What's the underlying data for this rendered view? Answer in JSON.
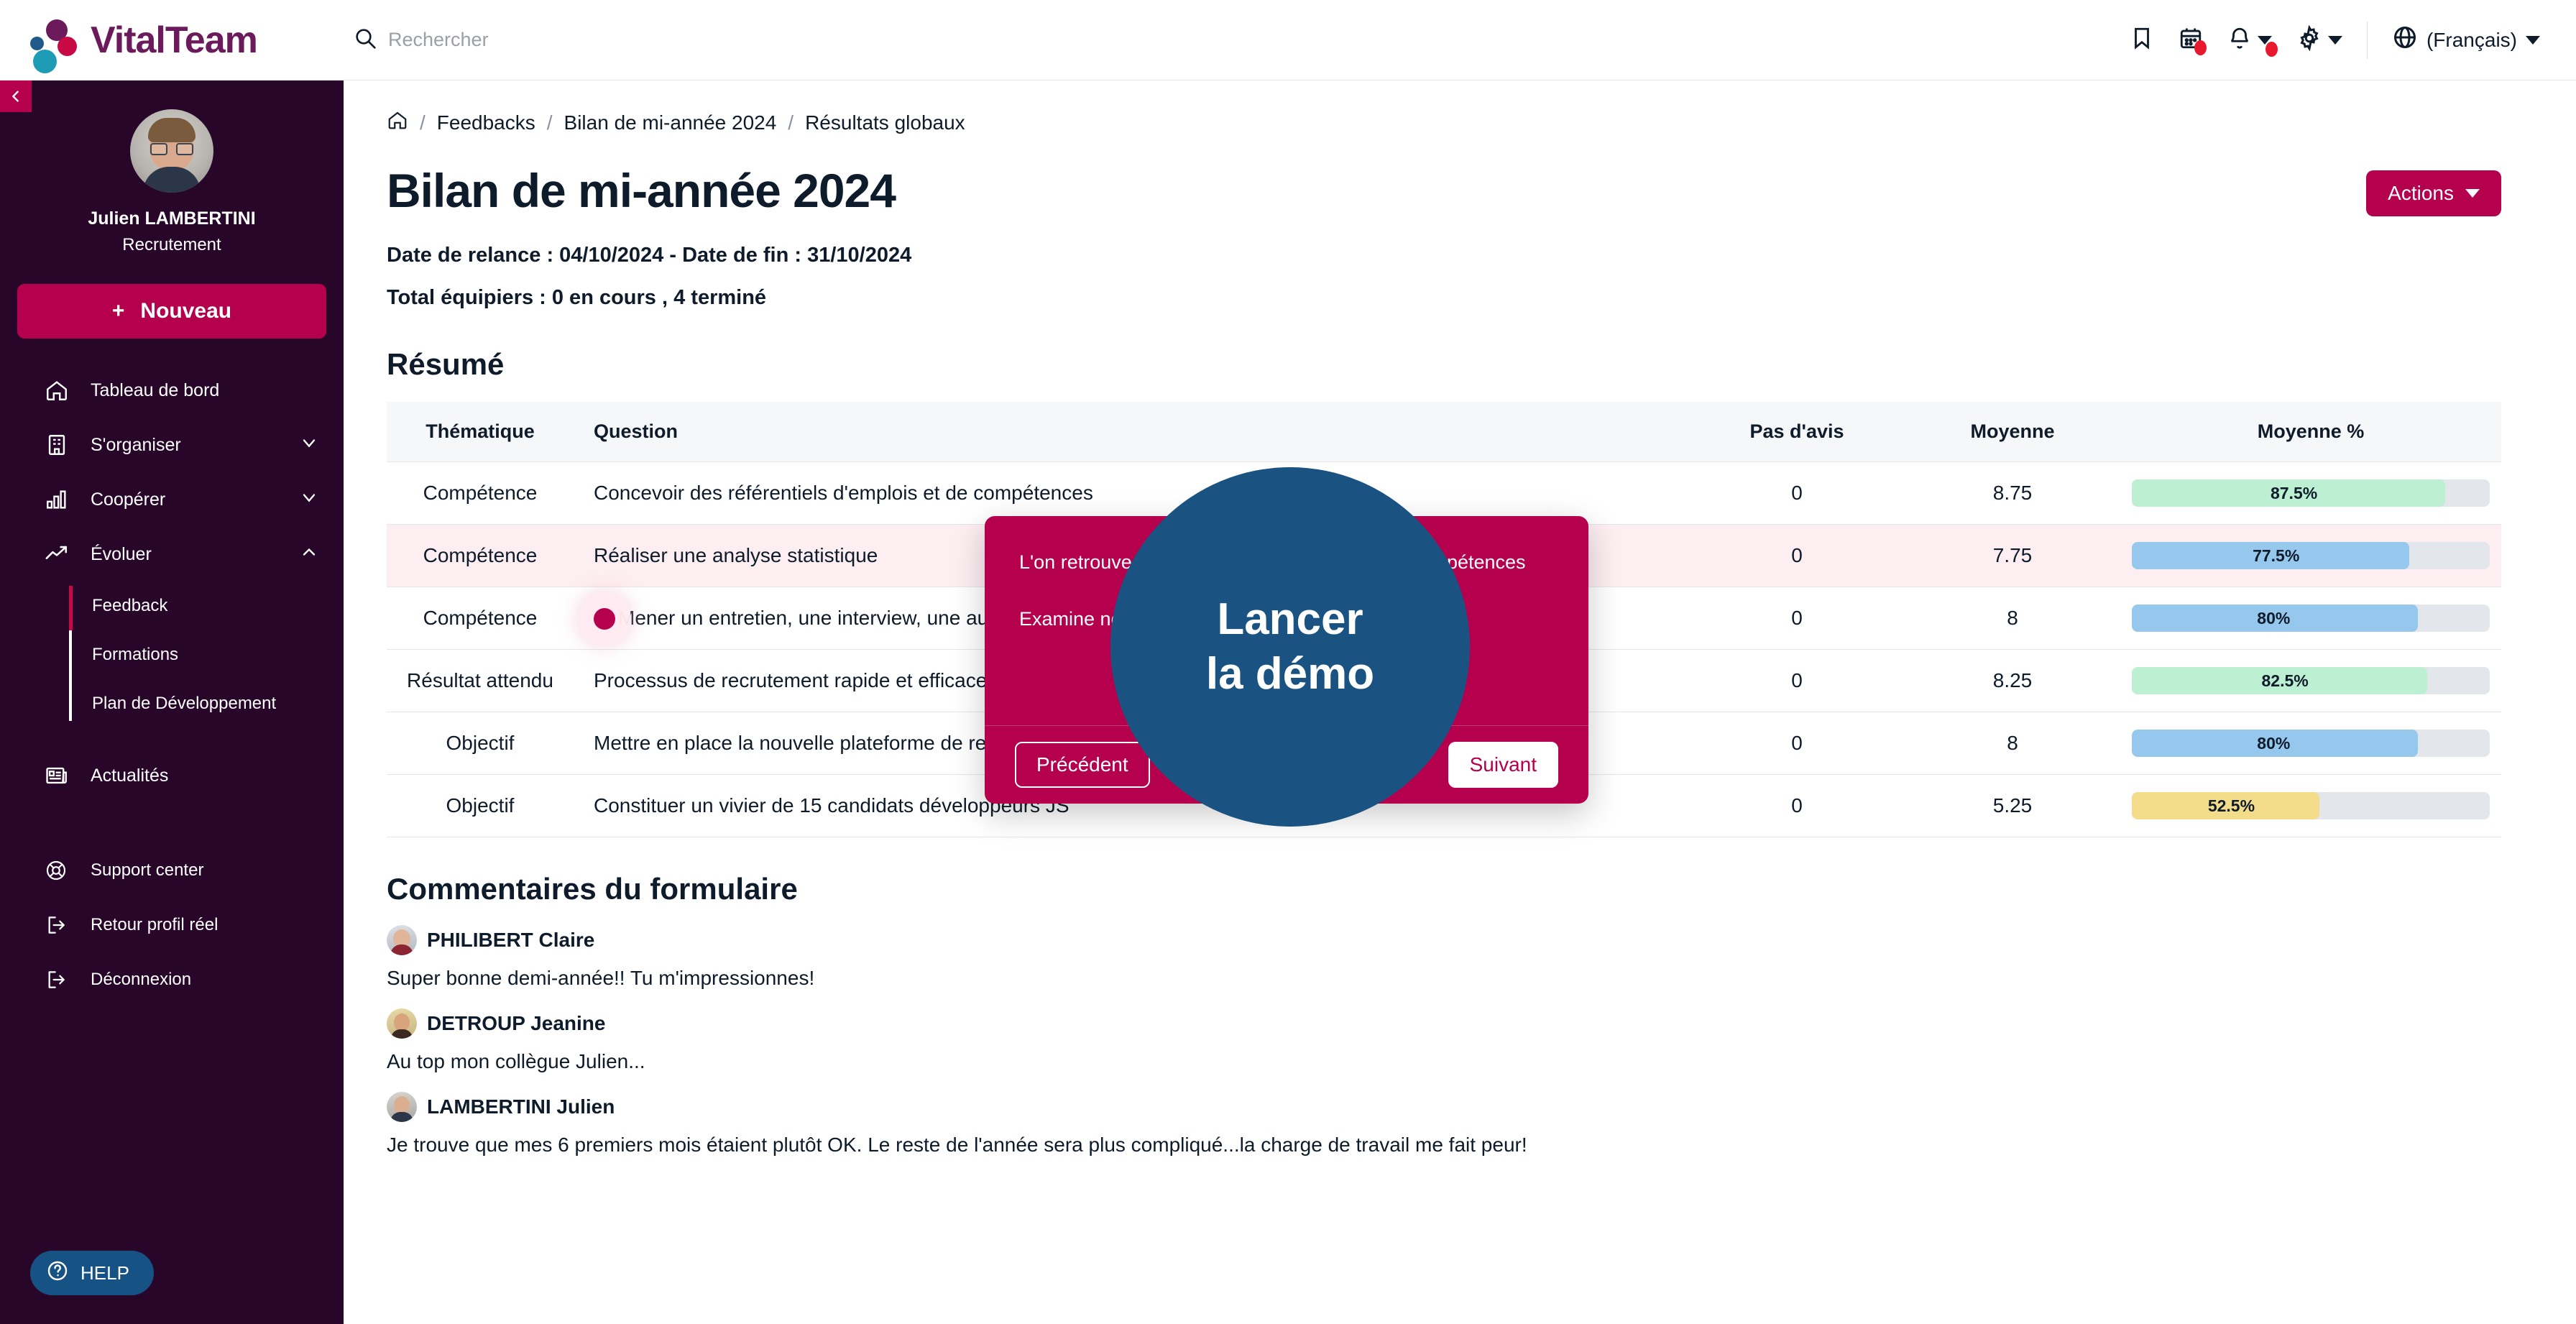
{
  "brand": {
    "name": "VitalTeam",
    "accent": "#b5004d",
    "sidebar_bg": "#28062a",
    "logo_purple": "#6b1b5c"
  },
  "topbar": {
    "search_placeholder": "Rechercher",
    "language": "(Français)"
  },
  "sidebar": {
    "user_name": "Julien LAMBERTINI",
    "user_role": "Recrutement",
    "new_button": "Nouveau",
    "new_button_plus": "+",
    "items": [
      {
        "label": "Tableau de bord",
        "icon": "home-icon",
        "expandable": false
      },
      {
        "label": "S'organiser",
        "icon": "building-icon",
        "expandable": true,
        "expanded": false
      },
      {
        "label": "Coopérer",
        "icon": "bar-chart-icon",
        "expandable": true,
        "expanded": false
      },
      {
        "label": "Évoluer",
        "icon": "trend-up-icon",
        "expandable": true,
        "expanded": true
      }
    ],
    "sub_items": [
      {
        "label": "Feedback",
        "active": true
      },
      {
        "label": "Formations",
        "active": false
      },
      {
        "label": "Plan de Développement",
        "active": false
      }
    ],
    "news": {
      "label": "Actualités",
      "icon": "news-icon"
    },
    "bottom_items": [
      {
        "label": "Support center",
        "icon": "lifebuoy-icon"
      },
      {
        "label": "Retour profil réel",
        "icon": "logout-icon"
      },
      {
        "label": "Déconnexion",
        "icon": "logout-icon"
      }
    ],
    "help_button": "HELP"
  },
  "breadcrumb": {
    "home_icon": "home-icon",
    "items": [
      "Feedbacks",
      "Bilan de mi-année 2024",
      "Résultats globaux"
    ],
    "separator": "/"
  },
  "page": {
    "title": "Bilan de mi-année 2024",
    "actions_button": "Actions",
    "relance_line": "Date de relance : 04/10/2024 - Date de fin : 31/10/2024",
    "total_line": "Total équipiers : 0 en cours , 4 terminé",
    "summary_heading": "Résumé",
    "comments_heading": "Commentaires du formulaire"
  },
  "table": {
    "headers": [
      "Thématique",
      "Question",
      "Pas d'avis",
      "Moyenne",
      "Moyenne %"
    ],
    "rows": [
      {
        "thematique": "Compétence",
        "question": "Concevoir des référentiels d'emplois et de compétences",
        "pas_davis": "0",
        "moyenne": "8.75",
        "pct_label": "87.5%",
        "pct": 87.5,
        "color": "#bdf0d2",
        "highlight": false,
        "marker": false
      },
      {
        "thematique": "Compétence",
        "question": "Réaliser une analyse statistique",
        "pas_davis": "0",
        "moyenne": "7.75",
        "pct_label": "77.5%",
        "pct": 77.5,
        "color": "#96c8ee",
        "highlight": true,
        "marker": false
      },
      {
        "thematique": "Compétence",
        "question": "Mener un entretien, une interview, une audition",
        "pas_davis": "0",
        "moyenne": "8",
        "pct_label": "80%",
        "pct": 80,
        "color": "#96c8ee",
        "highlight": false,
        "marker": true
      },
      {
        "thematique": "Résultat attendu",
        "question": "Processus de recrutement rapide et efficace",
        "pas_davis": "0",
        "moyenne": "8.25",
        "pct_label": "82.5%",
        "pct": 82.5,
        "color": "#bdf0d2",
        "highlight": false,
        "marker": false
      },
      {
        "thematique": "Objectif",
        "question": "Mettre en place la nouvelle plateforme de recrutement",
        "pas_davis": "0",
        "moyenne": "8",
        "pct_label": "80%",
        "pct": 80,
        "color": "#96c8ee",
        "highlight": false,
        "marker": false
      },
      {
        "thematique": "Objectif",
        "question": "Constituer un vivier de 15 candidats développeurs JS",
        "pas_davis": "0",
        "moyenne": "5.25",
        "pct_label": "52.5%",
        "pct": 52.5,
        "color": "#f3dd8a",
        "highlight": false,
        "marker": false
      }
    ]
  },
  "comments": [
    {
      "author": "PHILIBERT Claire",
      "text": "Super bonne demi-année!! Tu m'impressionnes!"
    },
    {
      "author": "DETROUP Jeanine",
      "text": "Au top mon collègue Julien..."
    },
    {
      "author": "LAMBERTINI Julien",
      "text": "Je trouve que mes 6 premiers mois étaient plutôt OK. Le reste de l'année sera plus compliqué...la charge de travail me fait peur!"
    }
  ],
  "demo_modal": {
    "paragraph_1": "L'on retrouve ici le détail des questions et les compétences",
    "paragraph_2": "Examine                                             nce MENER U",
    "prev_button": "Précédent",
    "next_button": "Suivant",
    "overlay_line_1": "Lancer",
    "overlay_line_2": "la démo",
    "overlay_color": "#1a5381"
  }
}
